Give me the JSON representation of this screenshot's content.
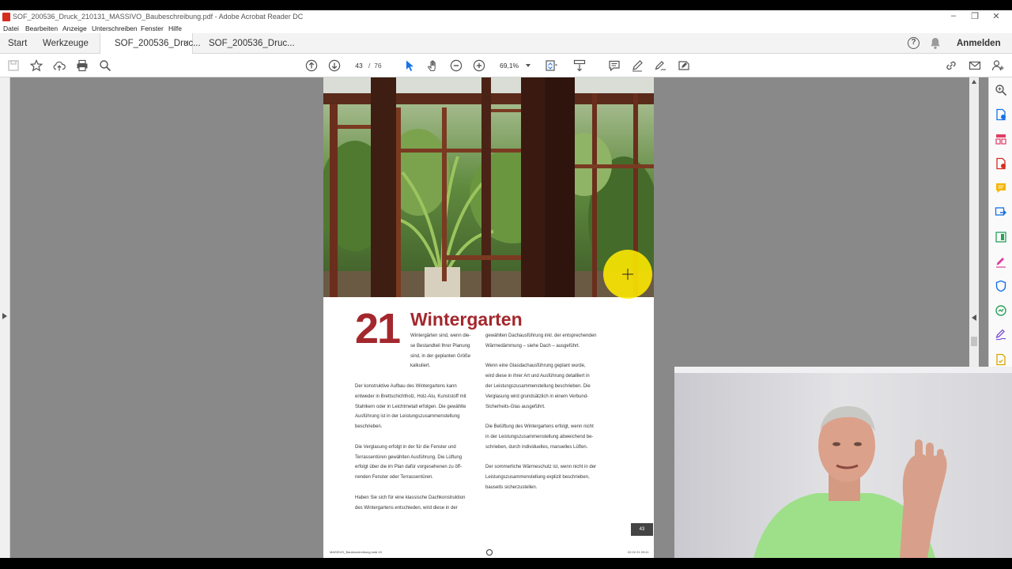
{
  "window": {
    "title": "SOF_200536_Druck_210131_MASSIVO_Baubeschreibung.pdf - Adobe Acrobat Reader DC",
    "controls": [
      "–",
      "❐",
      "✕"
    ]
  },
  "menu": {
    "items": [
      "Datei",
      "Bearbeiten",
      "Anzeige",
      "Unterschreiben",
      "Fenster",
      "Hilfe"
    ]
  },
  "tabs": {
    "start": "Start",
    "tools": "Werkzeuge",
    "doc1": "SOF_200536_Druc...",
    "doc2": "SOF_200536_Druc...",
    "close": "×"
  },
  "header": {
    "signin": "Anmelden"
  },
  "toolbar": {
    "current_page": "43",
    "page_separator": "/",
    "total_pages": "76",
    "zoom": "69,1%"
  },
  "document": {
    "chapter_number": "21",
    "chapter_title": "Wintergarten",
    "col1": [
      "Wintergärten sind, wenn die-\nse Bestandteil Ihrer Planung\nsind, in der geplanten Größe kalkuliert.",
      "Der konstruktive Aufbau des Wintergartens kann\nentweder in Brettschichtholz, Holz-Alu, Kunststoff mit\nStahlkern oder in Leichtmetall erfolgen. Die gewählte\nAusführung ist in der Leistungszusammenstellung\nbeschrieben.",
      "Die Verglasung erfolgt in der für die Fenster und\nTerrassentüren gewählten Ausführung. Die Lüftung\nerfolgt über die im Plan dafür vorgesehenen zu öff-\nnenden Fenster oder Terrassentüren.",
      "Haben Sie sich für eine klassische Dachkonstruktion\ndes Wintergartens entschieden, wird diese in der"
    ],
    "col2": [
      "gewählten Dachausführung inkl. der entsprechenden\nWärmedämmung – siehe Dach – ausgeführt.",
      "Wenn eine Glasdachausführung geplant wurde,\nwird diese in ihrer Art und Ausführung detailliert in\nder Leistungszusammenstellung beschrieben. Die\nVerglasung wird grundsätzlich in einem Verbund-\nSicherheits-Glas ausgeführt.",
      "Die Belüftung des Wintergartens erfolgt, wenn nicht\nin der Leistungszusammenstellung abweichend be-\nschrieben, durch individuelles, manuelles Lüften.",
      "Der sommerliche Wärmeschutz ist, wenn nicht in der\nLeistungszusammenstellung explizit beschrieben,\nbauseits sicherzustellen."
    ],
    "page_number": "43",
    "footer_left": "MASSIVO_Baubeschreibung.indd 43",
    "footer_right": "02.02.21 09:41"
  },
  "colors": {
    "accent_red": "#a3282d",
    "acrobat_red": "#d62c1f",
    "highlight_yellow": "#ffeb00"
  }
}
